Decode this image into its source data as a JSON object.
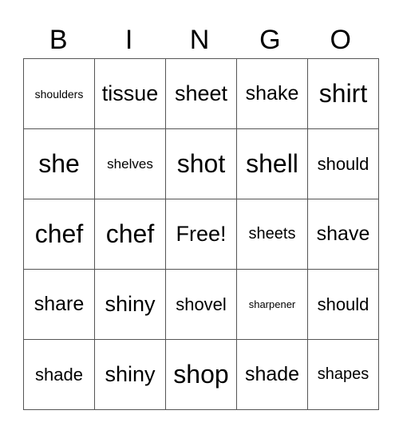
{
  "header": {
    "letters": [
      "B",
      "I",
      "N",
      "G",
      "O"
    ]
  },
  "card": {
    "rows": [
      [
        "shoulders",
        "tissue",
        "sheet",
        "shake",
        "shirt"
      ],
      [
        "she",
        "shelves",
        "shot",
        "shell",
        "should"
      ],
      [
        "chef",
        "chef",
        "Free!",
        "sheets",
        "shave"
      ],
      [
        "share",
        "shiny",
        "shovel",
        "sharpener",
        "should"
      ],
      [
        "shade",
        "shiny",
        "shop",
        "shade",
        "shapes"
      ]
    ]
  }
}
